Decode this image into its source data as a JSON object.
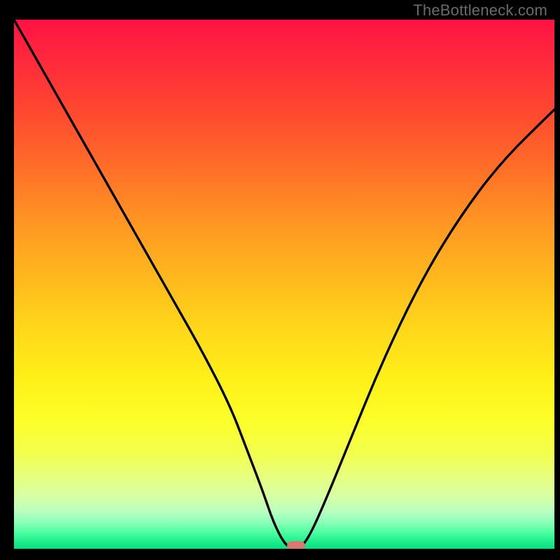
{
  "watermark": "TheBottleneck.com",
  "chart_data": {
    "type": "line",
    "title": "",
    "xlabel": "",
    "ylabel": "",
    "xlim": [
      0,
      100
    ],
    "ylim": [
      0,
      100
    ],
    "background_gradient": {
      "top": "#ff1344",
      "mid": "#fff018",
      "bottom": "#0fdd82"
    },
    "series": [
      {
        "name": "bottleneck-curve",
        "x": [
          0,
          5,
          10,
          15,
          20,
          25,
          30,
          35,
          40,
          43,
          46,
          48,
          50,
          51.5,
          53,
          55,
          58,
          62,
          68,
          75,
          82,
          90,
          100
        ],
        "y": [
          100,
          91,
          82,
          73,
          64,
          55,
          46,
          37,
          27,
          19,
          11,
          5,
          1,
          0,
          0,
          3,
          10,
          20,
          35,
          50,
          62,
          73,
          83
        ],
        "color": "#000000"
      }
    ],
    "marker": {
      "x": 52.2,
      "y": 0.5,
      "color": "#d57a72"
    }
  }
}
